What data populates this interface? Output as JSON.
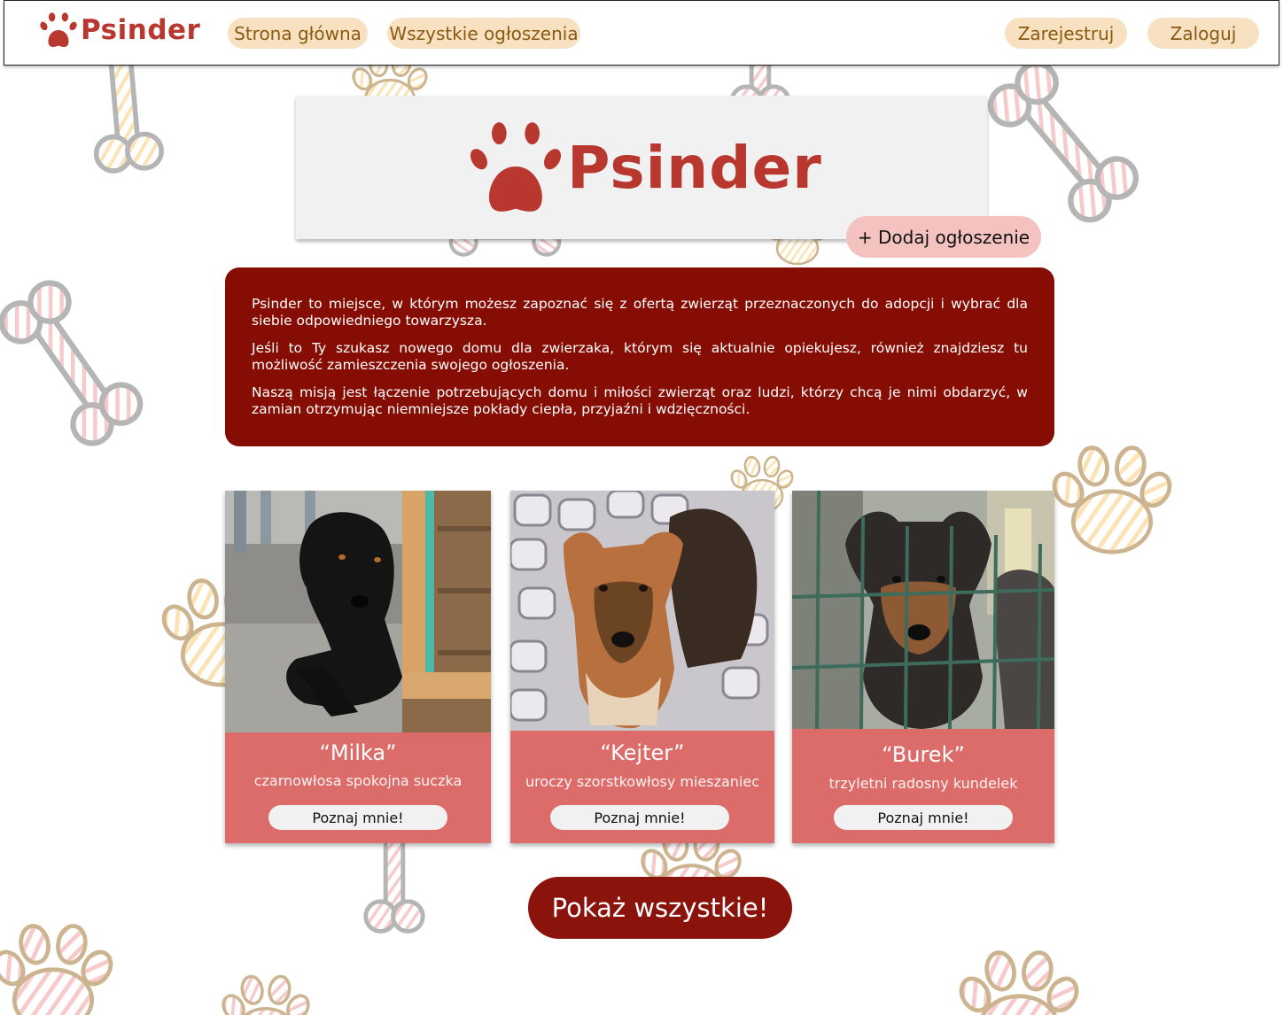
{
  "colors": {
    "brand": "#b8372e",
    "nav_pill": "#f7e1c0",
    "nav_pill_text": "#8a5a12",
    "add_button": "#f4c3c0",
    "about_bg": "#860d03",
    "card_bg": "#dc6c6a",
    "show_all_bg": "#8a140c"
  },
  "navbar": {
    "logo_text": "Psinder",
    "links": [
      "Strona główna",
      "Wszystkie ogłoszenia"
    ],
    "register_label": "Zarejestruj",
    "login_label": "Zaloguj"
  },
  "hero": {
    "logo_text": "Psinder",
    "add_button_label": "+ Dodaj ogłoszenie"
  },
  "about": {
    "paragraphs": [
      "Psinder to miejsce, w którym możesz zapoznać się z ofertą zwierząt przeznaczonych do adopcji i wybrać dla siebie odpowiedniego towarzysza.",
      "Jeśli to Ty szukasz nowego domu dla zwierzaka, którym się aktualnie opiekujesz, również znajdziesz tu możliwość zamieszczenia swojego ogłoszenia.",
      "Naszą misją jest łączenie potrzebujących domu i miłości zwierząt oraz ludzi, którzy chcą je nimi obdarzyć, w zamian otrzymując niemniejsze pokłady ciepła, przyjaźni i wdzięczności."
    ]
  },
  "cards": [
    {
      "name": "“Milka”",
      "description": "czarnowłosa spokojna suczka",
      "button_label": "Poznaj mnie!"
    },
    {
      "name": "“Kejter”",
      "description": "uroczy szorstkowłosy mieszaniec",
      "button_label": "Poznaj mnie!"
    },
    {
      "name": "“Burek”",
      "description": "trzyletni radosny kundelek",
      "button_label": "Poznaj mnie!"
    }
  ],
  "show_all_label": "Pokaż wszystkie!"
}
